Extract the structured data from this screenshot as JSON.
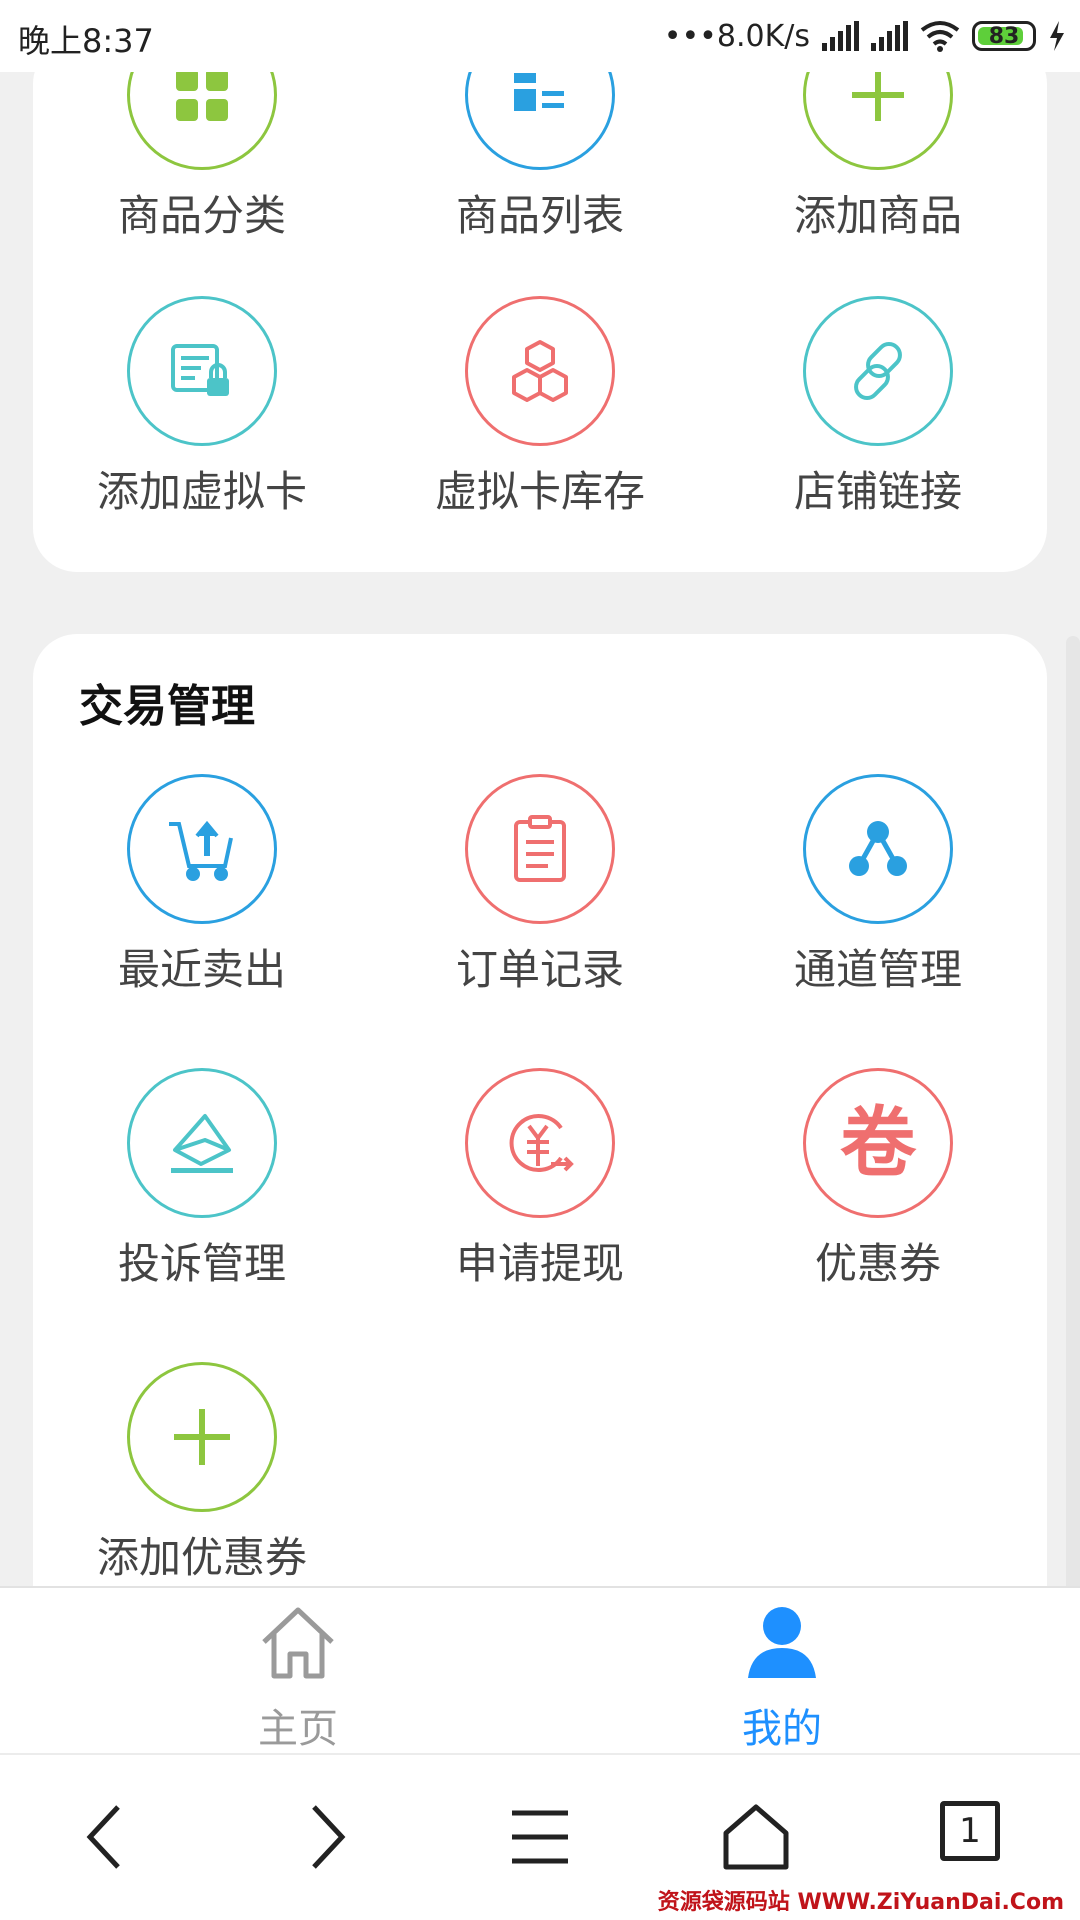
{
  "status": {
    "time": "晚上8:37",
    "net_speed": "•••8.0K/s",
    "battery": "83"
  },
  "colors": {
    "green": "#8dc63f",
    "blue": "#2aa0e0",
    "teal": "#4cc4c8",
    "red": "#ef6f6f",
    "active": "#1e90ff",
    "inactive": "#9a9a9a"
  },
  "goods": {
    "items": [
      {
        "label": "商品分类",
        "icon": "category-icon"
      },
      {
        "label": "商品列表",
        "icon": "list-icon"
      },
      {
        "label": "添加商品",
        "icon": "add-icon"
      },
      {
        "label": "添加虚拟卡",
        "icon": "virtual-card-lock-icon"
      },
      {
        "label": "虚拟卡库存",
        "icon": "boxes-icon"
      },
      {
        "label": "店铺链接",
        "icon": "link-icon"
      }
    ]
  },
  "trade": {
    "title": "交易管理",
    "items": [
      {
        "label": "最近卖出",
        "icon": "cart-upload-icon"
      },
      {
        "label": "订单记录",
        "icon": "clipboard-icon"
      },
      {
        "label": "通道管理",
        "icon": "share-nodes-icon"
      },
      {
        "label": "投诉管理",
        "icon": "envelope-icon"
      },
      {
        "label": "申请提现",
        "icon": "yuan-transfer-icon"
      },
      {
        "label": "优惠券",
        "icon": "coupon-icon",
        "glyph": "卷"
      },
      {
        "label": "添加优惠券",
        "icon": "plus-icon"
      }
    ]
  },
  "tabbar": {
    "tabs": [
      {
        "label": "主页",
        "icon": "home-icon",
        "active": false
      },
      {
        "label": "我的",
        "icon": "user-icon",
        "active": true
      }
    ]
  },
  "browser": {
    "tab_count": "1",
    "watermark": "资源袋源码站 WWW.ZiYuanDai.Com"
  }
}
